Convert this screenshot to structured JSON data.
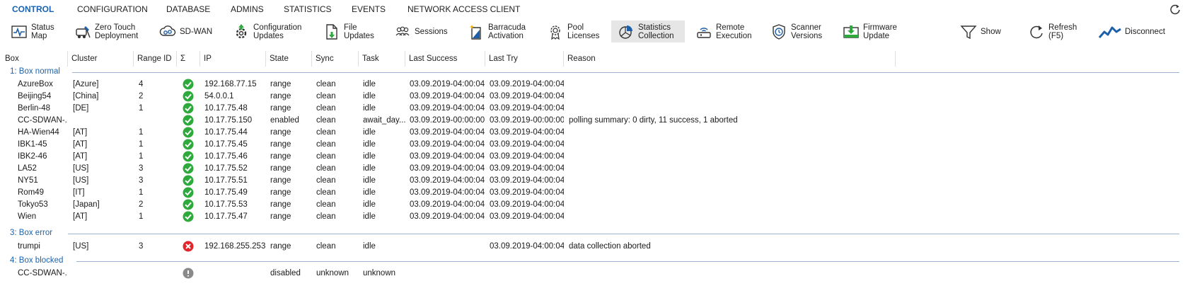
{
  "nav": {
    "tabs": [
      "CONTROL",
      "CONFIGURATION",
      "DATABASE",
      "ADMINS",
      "STATISTICS",
      "EVENTS",
      "NETWORK ACCESS CLIENT"
    ],
    "active": "CONTROL",
    "refresh_icon": "refresh-icon"
  },
  "toolbar": [
    {
      "label": "Status\nMap",
      "icon": "status-map-icon"
    },
    {
      "label": "Zero Touch\nDeployment",
      "icon": "zero-touch-icon"
    },
    {
      "label": "SD-WAN",
      "icon": "sd-wan-icon"
    },
    {
      "label": "Configuration\nUpdates",
      "icon": "configuration-updates-icon"
    },
    {
      "label": "File\nUpdates",
      "icon": "file-updates-icon"
    },
    {
      "label": "Sessions",
      "icon": "sessions-icon"
    },
    {
      "label": "Barracuda\nActivation",
      "icon": "activation-icon"
    },
    {
      "label": "Pool\nLicenses",
      "icon": "pool-licenses-icon"
    },
    {
      "label": "Statistics\nCollection",
      "icon": "statistics-collection-icon",
      "active": true
    },
    {
      "label": "Remote\nExecution",
      "icon": "remote-execution-icon"
    },
    {
      "label": "Scanner\nVersions",
      "icon": "scanner-versions-icon"
    },
    {
      "label": "Firmware\nUpdate",
      "icon": "firmware-update-icon"
    },
    {
      "label": "Show",
      "icon": "filter-icon"
    },
    {
      "label": "Refresh\n(F5)",
      "icon": "refresh-icon"
    },
    {
      "label": "Disconnect",
      "icon": "disconnect-icon"
    }
  ],
  "columns": [
    "Box",
    "Cluster",
    "Range ID",
    "Σ",
    "IP",
    "State",
    "Sync",
    "Task",
    "Last Success",
    "Last Try",
    "Reason"
  ],
  "groups": [
    {
      "label": "1: Box normal",
      "rows": [
        {
          "box": "AzureBox",
          "cluster": "[Azure]",
          "range": "4",
          "status": "ok",
          "ip": "192.168.77.15",
          "state": "range",
          "sync": "clean",
          "task": "idle",
          "last_success": "03.09.2019-04:00:04",
          "last_try": "03.09.2019-04:00:04",
          "reason": ""
        },
        {
          "box": "Beijing54",
          "cluster": "[China]",
          "range": "2",
          "status": "ok",
          "ip": "54.0.0.1",
          "state": "range",
          "sync": "clean",
          "task": "idle",
          "last_success": "03.09.2019-04:00:04",
          "last_try": "03.09.2019-04:00:04",
          "reason": ""
        },
        {
          "box": "Berlin-48",
          "cluster": "[DE]",
          "range": "1",
          "status": "ok",
          "ip": "10.17.75.48",
          "state": "range",
          "sync": "clean",
          "task": "idle",
          "last_success": "03.09.2019-04:00:04",
          "last_try": "03.09.2019-04:00:04",
          "reason": ""
        },
        {
          "box": "CC-SDWAN-...",
          "cluster": "",
          "range": "",
          "status": "ok",
          "ip": "10.17.75.150",
          "state": "enabled",
          "sync": "clean",
          "task": "await_day...",
          "last_success": "03.09.2019-00:00:00",
          "last_try": "03.09.2019-00:00:00",
          "reason": "polling summary: 0 dirty, 11 success, 1 aborted"
        },
        {
          "box": "HA-Wien44",
          "cluster": "[AT]",
          "range": "1",
          "status": "ok",
          "ip": "10.17.75.44",
          "state": "range",
          "sync": "clean",
          "task": "idle",
          "last_success": "03.09.2019-04:00:04",
          "last_try": "03.09.2019-04:00:04",
          "reason": ""
        },
        {
          "box": "IBK1-45",
          "cluster": "[AT]",
          "range": "1",
          "status": "ok",
          "ip": "10.17.75.45",
          "state": "range",
          "sync": "clean",
          "task": "idle",
          "last_success": "03.09.2019-04:00:04",
          "last_try": "03.09.2019-04:00:04",
          "reason": ""
        },
        {
          "box": "IBK2-46",
          "cluster": "[AT]",
          "range": "1",
          "status": "ok",
          "ip": "10.17.75.46",
          "state": "range",
          "sync": "clean",
          "task": "idle",
          "last_success": "03.09.2019-04:00:04",
          "last_try": "03.09.2019-04:00:04",
          "reason": ""
        },
        {
          "box": "LA52",
          "cluster": "[US]",
          "range": "3",
          "status": "ok",
          "ip": "10.17.75.52",
          "state": "range",
          "sync": "clean",
          "task": "idle",
          "last_success": "03.09.2019-04:00:04",
          "last_try": "03.09.2019-04:00:04",
          "reason": ""
        },
        {
          "box": "NY51",
          "cluster": "[US]",
          "range": "3",
          "status": "ok",
          "ip": "10.17.75.51",
          "state": "range",
          "sync": "clean",
          "task": "idle",
          "last_success": "03.09.2019-04:00:04",
          "last_try": "03.09.2019-04:00:04",
          "reason": ""
        },
        {
          "box": "Rom49",
          "cluster": "[IT]",
          "range": "1",
          "status": "ok",
          "ip": "10.17.75.49",
          "state": "range",
          "sync": "clean",
          "task": "idle",
          "last_success": "03.09.2019-04:00:04",
          "last_try": "03.09.2019-04:00:04",
          "reason": ""
        },
        {
          "box": "Tokyo53",
          "cluster": "[Japan]",
          "range": "2",
          "status": "ok",
          "ip": "10.17.75.53",
          "state": "range",
          "sync": "clean",
          "task": "idle",
          "last_success": "03.09.2019-04:00:04",
          "last_try": "03.09.2019-04:00:04",
          "reason": ""
        },
        {
          "box": "Wien",
          "cluster": "[AT]",
          "range": "1",
          "status": "ok",
          "ip": "10.17.75.47",
          "state": "range",
          "sync": "clean",
          "task": "idle",
          "last_success": "03.09.2019-04:00:04",
          "last_try": "03.09.2019-04:00:04",
          "reason": ""
        }
      ]
    },
    {
      "label": "3: Box error",
      "rows": [
        {
          "box": "trumpi",
          "cluster": "[US]",
          "range": "3",
          "status": "error",
          "ip": "192.168.255.253",
          "state": "range",
          "sync": "clean",
          "task": "idle",
          "last_success": "",
          "last_try": "03.09.2019-04:00:04",
          "reason": "data collection aborted"
        }
      ]
    },
    {
      "label": "4: Box blocked",
      "rows": [
        {
          "box": "CC-SDWAN-...",
          "cluster": "",
          "range": "",
          "status": "blocked",
          "ip": "",
          "state": "disabled",
          "sync": "unknown",
          "task": "unknown",
          "last_success": "",
          "last_try": "",
          "reason": ""
        }
      ]
    }
  ],
  "colors": {
    "accent": "#1a63b0",
    "ok": "#2eaa3c",
    "error": "#e0262b",
    "blocked": "#8a8a8a",
    "icon_blue": "#1d5fa8"
  }
}
